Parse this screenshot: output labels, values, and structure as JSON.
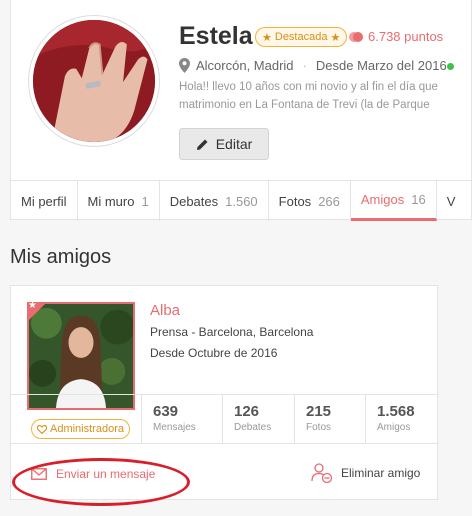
{
  "profile": {
    "name": "Estela",
    "badge": "Destacada",
    "points": "6.738 puntos",
    "location": "Alcorcón, Madrid",
    "since": "Desde Marzo del 2016",
    "bio_line1": "Hola!! llevo 10 años con mi novio y al fin el día que",
    "bio_line2": "matrimonio en La Fontana de Trevi (la de Parque",
    "edit_label": "Editar"
  },
  "tabs": [
    {
      "label": "Mi perfil",
      "count": ""
    },
    {
      "label": "Mi muro",
      "count": "1"
    },
    {
      "label": "Debates",
      "count": "1.560"
    },
    {
      "label": "Fotos",
      "count": "266"
    },
    {
      "label": "Amigos",
      "count": "16"
    },
    {
      "label": "V",
      "count": ""
    }
  ],
  "section_title": "Mis amigos",
  "friend": {
    "name": "Alba",
    "location": "Prensa - Barcelona, Barcelona",
    "since": "Desde Octubre de 2016",
    "role_badge": "Administradora",
    "stats": [
      {
        "value": "639",
        "label": "Mensajes"
      },
      {
        "value": "126",
        "label": "Debates"
      },
      {
        "value": "215",
        "label": "Fotos"
      },
      {
        "value": "1.568",
        "label": "Amigos"
      }
    ],
    "send_message_label": "Enviar un mensaje",
    "remove_friend_label": "Eliminar amigo"
  },
  "colors": {
    "accent": "#e86c70",
    "gold": "#f2b33d",
    "online": "#3cc24b",
    "annotation": "#d81e2a"
  }
}
